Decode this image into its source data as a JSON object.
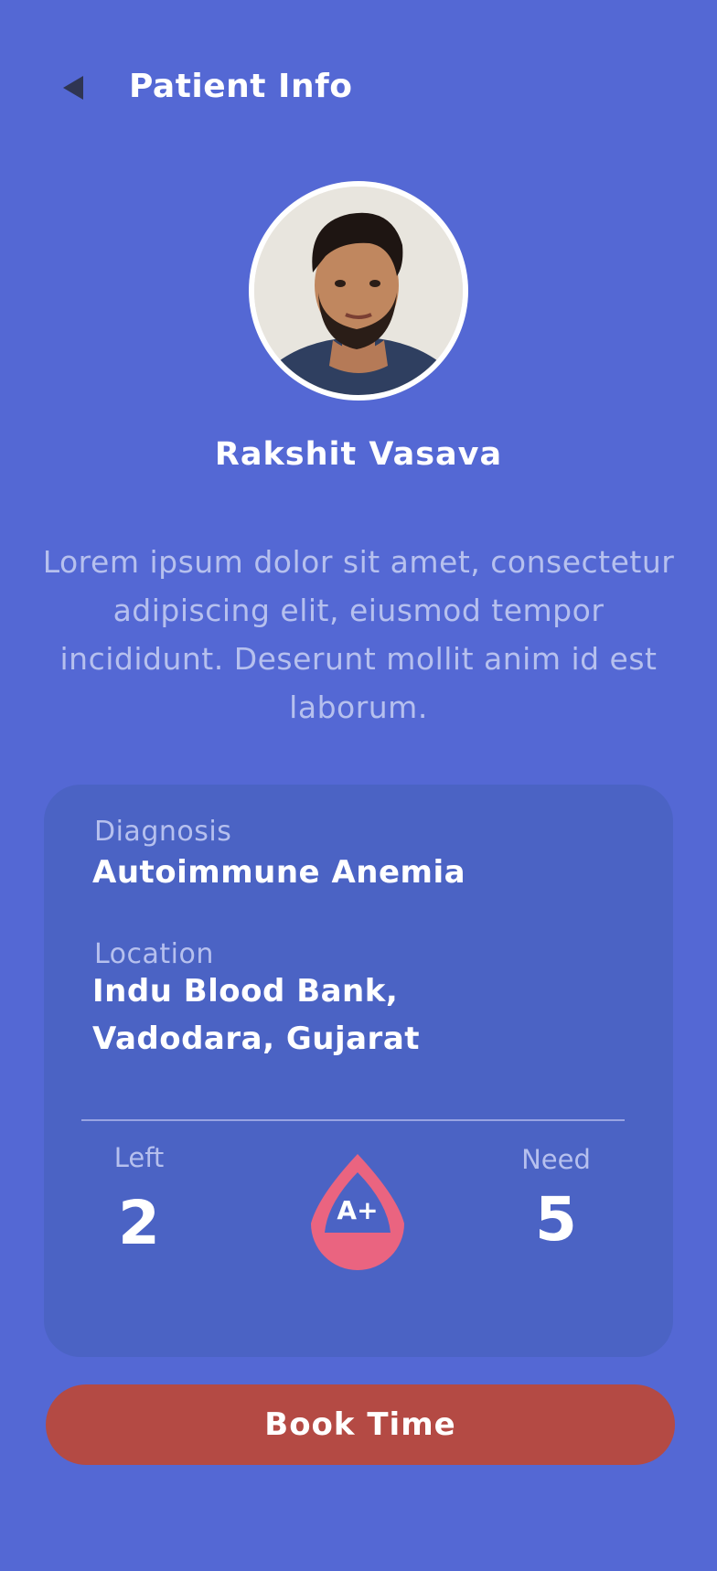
{
  "header": {
    "title": "Patient Info",
    "back_icon": "back-triangle-icon"
  },
  "patient": {
    "name": "Rakshit Vasava",
    "avatar_icon": "patient-avatar",
    "description": "Lorem ipsum dolor sit amet, consectetur adipiscing elit, eiusmod tempor incididunt. Deserunt mollit anim id est laborum."
  },
  "card": {
    "diagnosis_label": "Diagnosis",
    "diagnosis_value": "Autoimmune Anemia",
    "location_label": "Location",
    "location_line1": "Indu Blood Bank,",
    "location_line2": "Vadodara, Gujarat",
    "left_label": "Left",
    "left_value": "2",
    "need_label": "Need",
    "need_value": "5",
    "blood_type": "A+",
    "blood_icon": "blood-drop-icon"
  },
  "actions": {
    "book_label": "Book Time"
  },
  "colors": {
    "background": "#5468d4",
    "card": "#4b63c4",
    "drop": "#ea6480",
    "button": "#b44a44",
    "muted_text": "#b6c0ee"
  }
}
